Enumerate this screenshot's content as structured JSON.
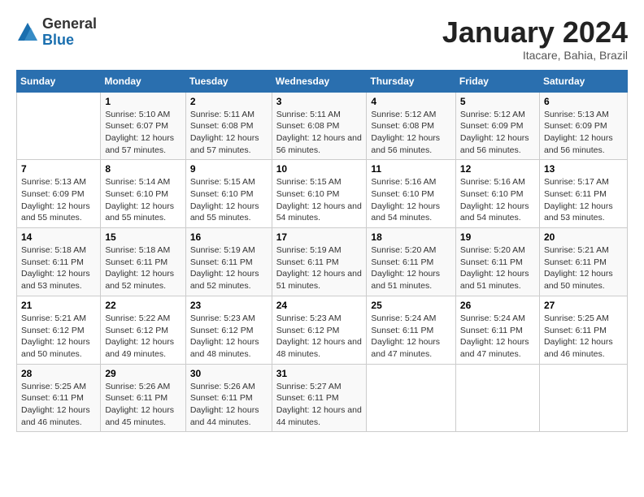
{
  "logo": {
    "general": "General",
    "blue": "Blue"
  },
  "title": "January 2024",
  "subtitle": "Itacare, Bahia, Brazil",
  "headers": [
    "Sunday",
    "Monday",
    "Tuesday",
    "Wednesday",
    "Thursday",
    "Friday",
    "Saturday"
  ],
  "weeks": [
    [
      {
        "day": "",
        "sunrise": "",
        "sunset": "",
        "daylight": ""
      },
      {
        "day": "1",
        "sunrise": "Sunrise: 5:10 AM",
        "sunset": "Sunset: 6:07 PM",
        "daylight": "Daylight: 12 hours and 57 minutes."
      },
      {
        "day": "2",
        "sunrise": "Sunrise: 5:11 AM",
        "sunset": "Sunset: 6:08 PM",
        "daylight": "Daylight: 12 hours and 57 minutes."
      },
      {
        "day": "3",
        "sunrise": "Sunrise: 5:11 AM",
        "sunset": "Sunset: 6:08 PM",
        "daylight": "Daylight: 12 hours and 56 minutes."
      },
      {
        "day": "4",
        "sunrise": "Sunrise: 5:12 AM",
        "sunset": "Sunset: 6:08 PM",
        "daylight": "Daylight: 12 hours and 56 minutes."
      },
      {
        "day": "5",
        "sunrise": "Sunrise: 5:12 AM",
        "sunset": "Sunset: 6:09 PM",
        "daylight": "Daylight: 12 hours and 56 minutes."
      },
      {
        "day": "6",
        "sunrise": "Sunrise: 5:13 AM",
        "sunset": "Sunset: 6:09 PM",
        "daylight": "Daylight: 12 hours and 56 minutes."
      }
    ],
    [
      {
        "day": "7",
        "sunrise": "Sunrise: 5:13 AM",
        "sunset": "Sunset: 6:09 PM",
        "daylight": "Daylight: 12 hours and 55 minutes."
      },
      {
        "day": "8",
        "sunrise": "Sunrise: 5:14 AM",
        "sunset": "Sunset: 6:10 PM",
        "daylight": "Daylight: 12 hours and 55 minutes."
      },
      {
        "day": "9",
        "sunrise": "Sunrise: 5:15 AM",
        "sunset": "Sunset: 6:10 PM",
        "daylight": "Daylight: 12 hours and 55 minutes."
      },
      {
        "day": "10",
        "sunrise": "Sunrise: 5:15 AM",
        "sunset": "Sunset: 6:10 PM",
        "daylight": "Daylight: 12 hours and 54 minutes."
      },
      {
        "day": "11",
        "sunrise": "Sunrise: 5:16 AM",
        "sunset": "Sunset: 6:10 PM",
        "daylight": "Daylight: 12 hours and 54 minutes."
      },
      {
        "day": "12",
        "sunrise": "Sunrise: 5:16 AM",
        "sunset": "Sunset: 6:10 PM",
        "daylight": "Daylight: 12 hours and 54 minutes."
      },
      {
        "day": "13",
        "sunrise": "Sunrise: 5:17 AM",
        "sunset": "Sunset: 6:11 PM",
        "daylight": "Daylight: 12 hours and 53 minutes."
      }
    ],
    [
      {
        "day": "14",
        "sunrise": "Sunrise: 5:18 AM",
        "sunset": "Sunset: 6:11 PM",
        "daylight": "Daylight: 12 hours and 53 minutes."
      },
      {
        "day": "15",
        "sunrise": "Sunrise: 5:18 AM",
        "sunset": "Sunset: 6:11 PM",
        "daylight": "Daylight: 12 hours and 52 minutes."
      },
      {
        "day": "16",
        "sunrise": "Sunrise: 5:19 AM",
        "sunset": "Sunset: 6:11 PM",
        "daylight": "Daylight: 12 hours and 52 minutes."
      },
      {
        "day": "17",
        "sunrise": "Sunrise: 5:19 AM",
        "sunset": "Sunset: 6:11 PM",
        "daylight": "Daylight: 12 hours and 51 minutes."
      },
      {
        "day": "18",
        "sunrise": "Sunrise: 5:20 AM",
        "sunset": "Sunset: 6:11 PM",
        "daylight": "Daylight: 12 hours and 51 minutes."
      },
      {
        "day": "19",
        "sunrise": "Sunrise: 5:20 AM",
        "sunset": "Sunset: 6:11 PM",
        "daylight": "Daylight: 12 hours and 51 minutes."
      },
      {
        "day": "20",
        "sunrise": "Sunrise: 5:21 AM",
        "sunset": "Sunset: 6:11 PM",
        "daylight": "Daylight: 12 hours and 50 minutes."
      }
    ],
    [
      {
        "day": "21",
        "sunrise": "Sunrise: 5:21 AM",
        "sunset": "Sunset: 6:12 PM",
        "daylight": "Daylight: 12 hours and 50 minutes."
      },
      {
        "day": "22",
        "sunrise": "Sunrise: 5:22 AM",
        "sunset": "Sunset: 6:12 PM",
        "daylight": "Daylight: 12 hours and 49 minutes."
      },
      {
        "day": "23",
        "sunrise": "Sunrise: 5:23 AM",
        "sunset": "Sunset: 6:12 PM",
        "daylight": "Daylight: 12 hours and 48 minutes."
      },
      {
        "day": "24",
        "sunrise": "Sunrise: 5:23 AM",
        "sunset": "Sunset: 6:12 PM",
        "daylight": "Daylight: 12 hours and 48 minutes."
      },
      {
        "day": "25",
        "sunrise": "Sunrise: 5:24 AM",
        "sunset": "Sunset: 6:11 PM",
        "daylight": "Daylight: 12 hours and 47 minutes."
      },
      {
        "day": "26",
        "sunrise": "Sunrise: 5:24 AM",
        "sunset": "Sunset: 6:11 PM",
        "daylight": "Daylight: 12 hours and 47 minutes."
      },
      {
        "day": "27",
        "sunrise": "Sunrise: 5:25 AM",
        "sunset": "Sunset: 6:11 PM",
        "daylight": "Daylight: 12 hours and 46 minutes."
      }
    ],
    [
      {
        "day": "28",
        "sunrise": "Sunrise: 5:25 AM",
        "sunset": "Sunset: 6:11 PM",
        "daylight": "Daylight: 12 hours and 46 minutes."
      },
      {
        "day": "29",
        "sunrise": "Sunrise: 5:26 AM",
        "sunset": "Sunset: 6:11 PM",
        "daylight": "Daylight: 12 hours and 45 minutes."
      },
      {
        "day": "30",
        "sunrise": "Sunrise: 5:26 AM",
        "sunset": "Sunset: 6:11 PM",
        "daylight": "Daylight: 12 hours and 44 minutes."
      },
      {
        "day": "31",
        "sunrise": "Sunrise: 5:27 AM",
        "sunset": "Sunset: 6:11 PM",
        "daylight": "Daylight: 12 hours and 44 minutes."
      },
      {
        "day": "",
        "sunrise": "",
        "sunset": "",
        "daylight": ""
      },
      {
        "day": "",
        "sunrise": "",
        "sunset": "",
        "daylight": ""
      },
      {
        "day": "",
        "sunrise": "",
        "sunset": "",
        "daylight": ""
      }
    ]
  ]
}
